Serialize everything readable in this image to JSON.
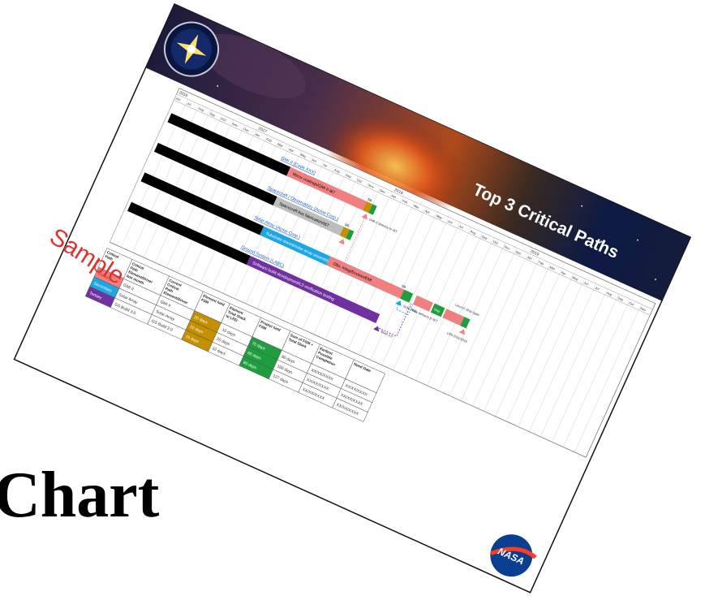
{
  "caption": "Chart",
  "slide": {
    "title": "Top 3 Critical Paths",
    "watermark": "Sample",
    "logo_right": "NASA",
    "years": [
      "2016",
      "2017",
      "2018",
      "2019"
    ],
    "months": [
      "Jun",
      "Jul",
      "Aug",
      "Sep",
      "Oct",
      "Nov",
      "Dec",
      "Jan",
      "Feb",
      "Mar",
      "Apr",
      "May",
      "Jun",
      "Jul",
      "Aug",
      "Sep",
      "Oct",
      "Nov",
      "Dec",
      "Jan",
      "Feb",
      "Mar",
      "Apr",
      "May",
      "Jun",
      "Jul",
      "Aug",
      "Sep",
      "Oct",
      "Nov",
      "Dec",
      "Jan",
      "Feb",
      "Mar",
      "Apr",
      "May",
      "Jun",
      "Jul",
      "Aug",
      "Sep",
      "Oct",
      "Nov"
    ],
    "rows": [
      {
        "label": "GMI-II (Code XXX)",
        "bar_text": "Mirror coatings/GMI II I&T",
        "milestone": "GMI-II delivery to I&T"
      },
      {
        "label": "Spacecraft / Observatory (Acme Corp.)",
        "bar_text": "Spacecraft bus fabrication/I&T",
        "milestone": "Obs. Integ/Environ/EMI"
      },
      {
        "label": "Solar Array (Acme Corp.)",
        "bar_text": "Substrate rework/solar array assembly & test",
        "milestone": "Solar Array delivery to I&T"
      },
      {
        "label": "Ground System (LABC)",
        "bar_text": "Software build development/L3 verification testing",
        "milestone": "Build 3.0"
      }
    ],
    "chart_labels": {
      "slack": "Slk",
      "tmc": "TMC",
      "ship": "Ship",
      "launch": "Launch Ship Date",
      "lrd": "LRD 8/31/2019"
    },
    "table": {
      "headers": [
        "Critical Path",
        "Critical Path Element/Driver last month",
        "Current Critical Path Element/Driver",
        "Element held FSM",
        "Element Total Slack to LRD",
        "Project held FSM",
        "Sum of FSM + Total Slack",
        "Earliest Possible Completion",
        "Need Date"
      ],
      "rows": [
        {
          "path": "Primary",
          "last": "GMI II",
          "current": "GMI II",
          "efsm": "20 days",
          "slack": "-10 days",
          "pfsm": "70 days",
          "sum": "80 days",
          "earliest": "XX/XX/XXXX",
          "need": "XX/XX/XXXX"
        },
        {
          "path": "Secondary",
          "last": "Solar Array",
          "current": "Solar Array",
          "efsm": "20 days",
          "slack": "20 days",
          "pfsm": "60 days",
          "sum": "100 days",
          "earliest": "XX/XX/XXXX",
          "need": "XX/XX/XXXX"
        },
        {
          "path": "Tertiary",
          "last": "GS Build 3.0",
          "current": "GS Build 3.0",
          "efsm": "15 days",
          "slack": "32 days",
          "pfsm": "80 days",
          "sum": "127 days",
          "earliest": "XX/XX/XXXX",
          "need": "XX/XX/XXXX"
        }
      ]
    }
  },
  "colors": {
    "primary": "#f08080",
    "secondary": "#1ca6e4",
    "tertiary": "#7030a0",
    "fsm": "#c49000",
    "pfsm": "#1e9e3e",
    "grey": "#bdbdbd",
    "link": "#2060c0",
    "sample": "#e03030"
  }
}
